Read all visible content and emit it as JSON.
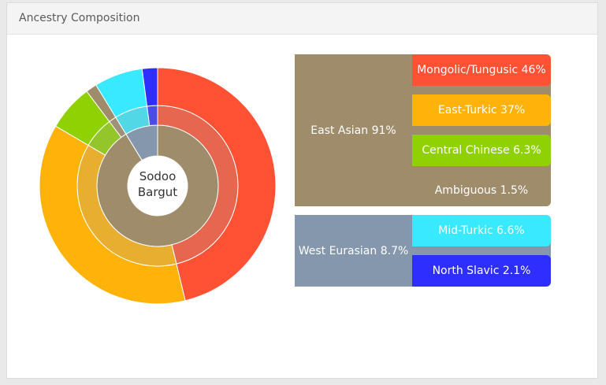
{
  "header": {
    "title": "Ancestry Composition"
  },
  "center_label": [
    "Sodoo",
    "Bargut"
  ],
  "chart_data": {
    "type": "sunburst",
    "title": "Ancestry Composition",
    "center": "Sodoo Bargut",
    "groups": [
      {
        "name": "East Asian",
        "label": "East Asian 91%",
        "value": 91,
        "color": "#9e8c6b",
        "children": [
          {
            "name": "Mongolic/Tungusic",
            "label": "Mongolic/Tungusic 46%",
            "value": 46,
            "color": "#ff5234"
          },
          {
            "name": "East-Turkic",
            "label": "East-Turkic 37%",
            "value": 37,
            "color": "#ffb20a"
          },
          {
            "name": "Central Chinese",
            "label": "Central Chinese 6.3%",
            "value": 6.3,
            "color": "#90d104"
          },
          {
            "name": "Ambiguous",
            "label": "Ambiguous 1.5%",
            "value": 1.5,
            "color": "#9e8c6b"
          }
        ]
      },
      {
        "name": "West Eurasian",
        "label": "West Eurasian 8.7%",
        "value": 8.7,
        "color": "#8597ad",
        "children": [
          {
            "name": "Mid-Turkic",
            "label": "Mid-Turkic 6.6%",
            "value": 6.6,
            "color": "#38e9ff"
          },
          {
            "name": "North Slavic",
            "label": "North Slavic 2.1%",
            "value": 2.1,
            "color": "#2e2eff"
          }
        ]
      }
    ]
  }
}
